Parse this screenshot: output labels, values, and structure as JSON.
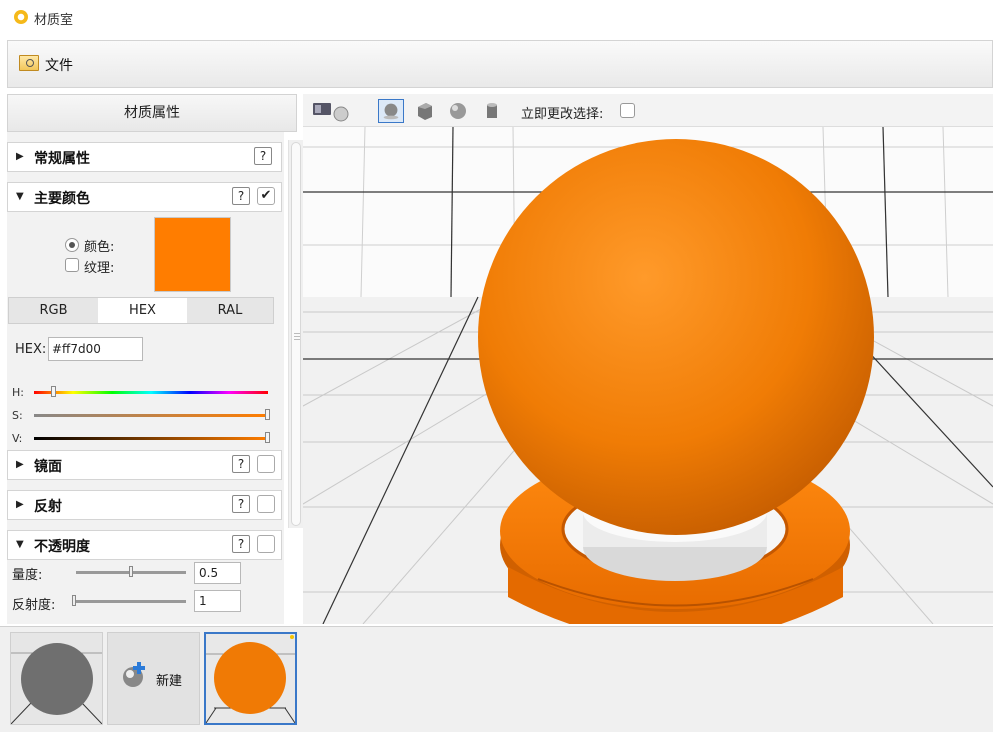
{
  "window": {
    "title": "材质室"
  },
  "menu": {
    "file_label": "文件"
  },
  "panel": {
    "header": "材质属性",
    "sections": {
      "general": "常规属性",
      "main_color": "主要颜色",
      "specular": "镜面",
      "reflection": "反射",
      "opacity": "不透明度"
    },
    "help_label": "?",
    "main_color_checked": "✔",
    "color_radio_label": "颜色:",
    "texture_label": "纹理:",
    "color_value": "#ff7d00",
    "tabs": [
      "RGB",
      "HEX",
      "RAL"
    ],
    "active_tab": "HEX",
    "hex_label": "HEX:",
    "hex_value": "#ff7d00",
    "hsv": {
      "h_label": "H:",
      "s_label": "S:",
      "v_label": "V:",
      "h_fraction": 0.08,
      "s_fraction": 1.0,
      "v_fraction": 1.0
    },
    "opacity": {
      "amount_label": "量度:",
      "amount_value": "0.5",
      "reflectivity_label": "反射度:",
      "reflectivity_value": "1"
    }
  },
  "viewport_toolbar": {
    "apply_selection_label": "立即更改选择:"
  },
  "materials": {
    "new_label": "新建"
  },
  "colors": {
    "accent": "#ff7d00",
    "selection": "#3a78c8"
  }
}
